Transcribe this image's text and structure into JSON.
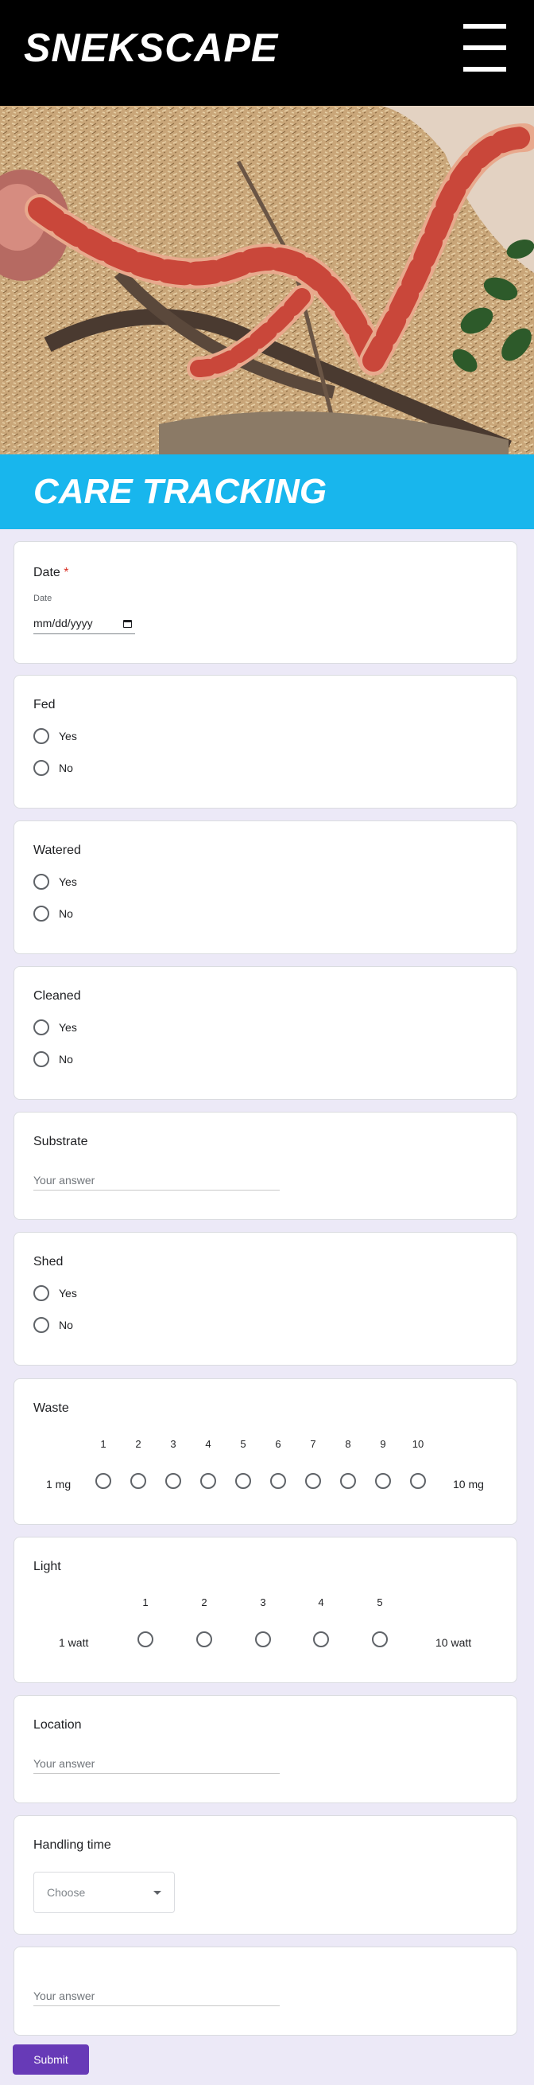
{
  "header": {
    "brand": "SNEKSCAPE",
    "menu_icon": "hamburger-menu-icon"
  },
  "hero": {
    "image": "corn snake on wood-chip substrate with branches and plant"
  },
  "banner": {
    "title": "CARE TRACKING",
    "color": "#18b6ed"
  },
  "form": {
    "date": {
      "title": "Date",
      "required_mark": "*",
      "sublabel": "Date",
      "placeholder": "mm/dd/yyyy",
      "icon": "calendar-icon"
    },
    "fed": {
      "title": "Fed",
      "options": [
        "Yes",
        "No"
      ]
    },
    "watered": {
      "title": "Watered",
      "options": [
        "Yes",
        "No"
      ]
    },
    "cleaned": {
      "title": "Cleaned",
      "options": [
        "Yes",
        "No"
      ]
    },
    "substrate": {
      "title": "Substrate",
      "placeholder": "Your answer"
    },
    "shed": {
      "title": "Shed",
      "options": [
        "Yes",
        "No"
      ]
    },
    "waste": {
      "title": "Waste",
      "scale": [
        "1",
        "2",
        "3",
        "4",
        "5",
        "6",
        "7",
        "8",
        "9",
        "10"
      ],
      "min_label": "1 mg",
      "max_label": "10 mg"
    },
    "light": {
      "title": "Light",
      "scale": [
        "1",
        "2",
        "3",
        "4",
        "5"
      ],
      "min_label": "1 watt",
      "max_label": "10 watt"
    },
    "location": {
      "title": "Location",
      "placeholder": "Your answer"
    },
    "handling": {
      "title": "Handling time",
      "dropdown_value": "Choose",
      "caret_icon": "caret-down-icon"
    },
    "other": {
      "placeholder": "Your answer"
    },
    "submit_label": "Submit",
    "accent": "#673ab7"
  }
}
